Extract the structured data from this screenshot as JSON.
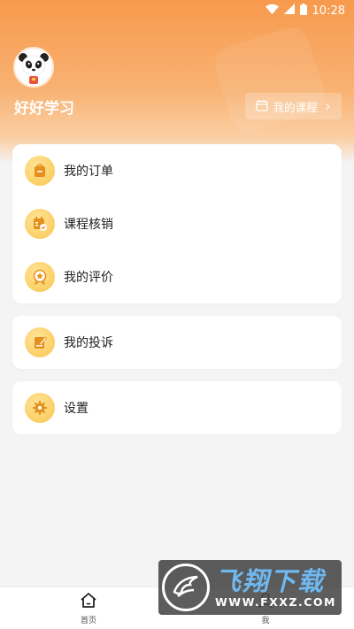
{
  "status_bar": {
    "time": "10:28",
    "wifi_icon": "wifi-icon",
    "signal_icon": "signal-icon",
    "battery_icon": "battery-icon"
  },
  "profile": {
    "avatar_icon": "panda-avatar",
    "username": "好好学习"
  },
  "course_button": {
    "icon": "calendar-icon",
    "label": "我的课程",
    "chevron": "›"
  },
  "menu_group_1": [
    {
      "label": "我的订单",
      "icon": "order-bag-icon"
    },
    {
      "label": "课程核销",
      "icon": "course-verify-icon"
    },
    {
      "label": "我的评价",
      "icon": "review-star-icon"
    }
  ],
  "menu_group_2": [
    {
      "label": "我的投诉",
      "icon": "complaint-note-icon"
    }
  ],
  "menu_group_3": [
    {
      "label": "设置",
      "icon": "settings-gear-icon"
    }
  ],
  "tabbar": [
    {
      "label": "首页",
      "icon": "home-icon"
    },
    {
      "label": "我",
      "icon": "profile-icon"
    }
  ],
  "watermark": {
    "title": "飞翔下载",
    "url": "WWW.FXXZ.COM"
  },
  "colors": {
    "accent": "#f79a4d",
    "icon_bg": "#fcd26b",
    "icon_fg": "#e58f1c",
    "page_bg": "#f4f4f5"
  }
}
